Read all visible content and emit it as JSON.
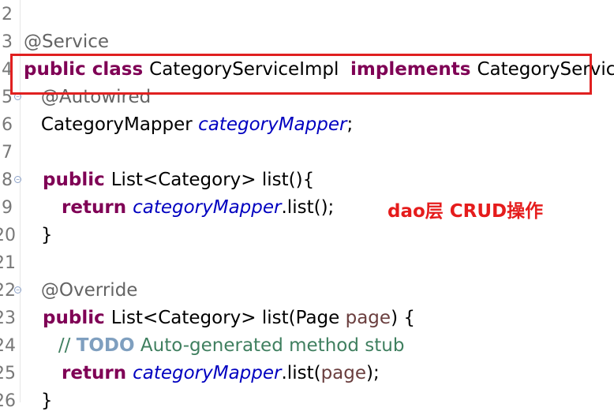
{
  "lines": [
    {
      "num": "2",
      "tokens": []
    },
    {
      "num": "3",
      "tokens": [
        {
          "t": "@Service",
          "c": "ann"
        }
      ]
    },
    {
      "num": "4",
      "tokens": [
        {
          "t": "public class ",
          "c": "kw"
        },
        {
          "t": "CategoryServiceImpl  ",
          "c": "txt"
        },
        {
          "t": "implements ",
          "c": "kw"
        },
        {
          "t": "CategoryService{",
          "c": "txt"
        }
      ]
    },
    {
      "num": "5",
      "fold": true,
      "tokens": [
        {
          "t": "   @Autowired",
          "c": "ann"
        }
      ]
    },
    {
      "num": "6",
      "tokens": [
        {
          "t": "   CategoryMapper ",
          "c": "txt"
        },
        {
          "t": "categoryMapper",
          "c": "field"
        },
        {
          "t": ";",
          "c": "txt"
        }
      ]
    },
    {
      "num": "7",
      "tokens": []
    },
    {
      "num": "8",
      "fold": true,
      "tokens": [
        {
          "t": "   public ",
          "c": "kw"
        },
        {
          "t": "List<Category> list(){",
          "c": "txt"
        }
      ]
    },
    {
      "num": "9",
      "tokens": [
        {
          "t": "      return ",
          "c": "kw"
        },
        {
          "t": "categoryMapper",
          "c": "field"
        },
        {
          "t": ".list();",
          "c": "txt"
        }
      ]
    },
    {
      "num": "20",
      "tokens": [
        {
          "t": "   }",
          "c": "txt"
        }
      ]
    },
    {
      "num": "21",
      "tokens": []
    },
    {
      "num": "22",
      "fold": true,
      "tokens": [
        {
          "t": "   @Override",
          "c": "ann"
        }
      ]
    },
    {
      "num": "23",
      "tokens": [
        {
          "t": "   public ",
          "c": "kw"
        },
        {
          "t": "List<Category> list(Page ",
          "c": "txt"
        },
        {
          "t": "page",
          "c": "param"
        },
        {
          "t": ") {",
          "c": "txt"
        }
      ]
    },
    {
      "num": "24",
      "tokens": [
        {
          "t": "      // ",
          "c": "cmt"
        },
        {
          "t": "TODO",
          "c": "todo"
        },
        {
          "t": " Auto-generated method stub",
          "c": "cmt"
        }
      ]
    },
    {
      "num": "25",
      "tokens": [
        {
          "t": "      return ",
          "c": "kw"
        },
        {
          "t": "categoryMapper",
          "c": "field"
        },
        {
          "t": ".list(",
          "c": "txt"
        },
        {
          "t": "page",
          "c": "param"
        },
        {
          "t": ");",
          "c": "txt"
        }
      ]
    },
    {
      "num": "26",
      "tokens": [
        {
          "t": "   }",
          "c": "txt"
        }
      ]
    }
  ],
  "annotation": {
    "text": "dao层 CRUD操作",
    "color": "#e51c1c"
  },
  "highlight": {
    "color": "#e02020"
  }
}
